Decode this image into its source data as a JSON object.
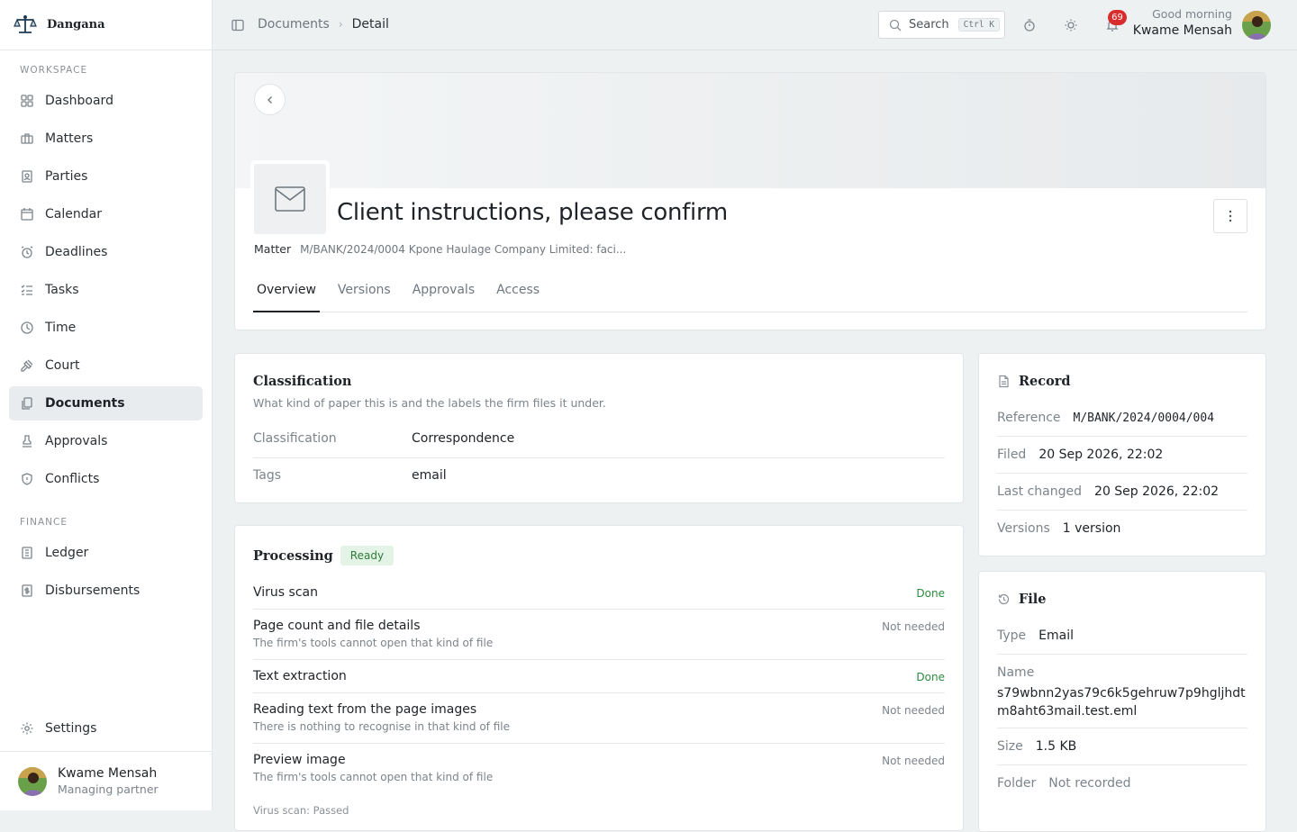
{
  "brand": {
    "name": "Dangana"
  },
  "sidebar": {
    "sections": [
      {
        "label": "Workspace"
      },
      {
        "label": "Finance"
      }
    ],
    "items": [
      {
        "label": "Dashboard",
        "icon": "dashboard-icon"
      },
      {
        "label": "Matters",
        "icon": "briefcase-icon"
      },
      {
        "label": "Parties",
        "icon": "contact-card-icon"
      },
      {
        "label": "Calendar",
        "icon": "calendar-icon"
      },
      {
        "label": "Deadlines",
        "icon": "alarm-clock-icon"
      },
      {
        "label": "Tasks",
        "icon": "checklist-icon"
      },
      {
        "label": "Time",
        "icon": "clock-icon"
      },
      {
        "label": "Court",
        "icon": "gavel-icon"
      },
      {
        "label": "Documents",
        "icon": "documents-icon",
        "active": true
      },
      {
        "label": "Approvals",
        "icon": "stamp-icon"
      },
      {
        "label": "Conflicts",
        "icon": "shield-icon"
      },
      {
        "label": "Ledger",
        "icon": "ledger-icon"
      },
      {
        "label": "Disbursements",
        "icon": "receipt-icon"
      }
    ],
    "settings": "Settings",
    "user": {
      "name": "Kwame Mensah",
      "role": "Managing partner"
    }
  },
  "topbar": {
    "breadcrumb": [
      "Documents",
      "Detail"
    ],
    "search": {
      "label": "Search",
      "shortcut": "Ctrl K"
    },
    "notifications": "69",
    "greeting": "Good morning",
    "user": "Kwame Mensah"
  },
  "document": {
    "title": "Client instructions, please confirm",
    "matter_label": "Matter",
    "matter_value": "M/BANK/2024/0004 Kpone Haulage Company Limited: faci...",
    "tabs": [
      "Overview",
      "Versions",
      "Approvals",
      "Access"
    ],
    "active_tab": "Overview"
  },
  "classification": {
    "title": "Classification",
    "subtitle": "What kind of paper this is and the labels the firm files it under.",
    "rows": [
      {
        "label": "Classification",
        "value": "Correspondence"
      },
      {
        "label": "Tags",
        "value": "email"
      }
    ]
  },
  "processing": {
    "title": "Processing",
    "badge": "Ready",
    "items": [
      {
        "title": "Virus scan",
        "sub": "",
        "status": "Done"
      },
      {
        "title": "Page count and file details",
        "sub": "The firm's tools cannot open that kind of file",
        "status": "Not needed"
      },
      {
        "title": "Text extraction",
        "sub": "",
        "status": "Done"
      },
      {
        "title": "Reading text from the page images",
        "sub": "There is nothing to recognise in that kind of file",
        "status": "Not needed"
      },
      {
        "title": "Preview image",
        "sub": "The firm's tools cannot open that kind of file",
        "status": "Not needed"
      }
    ],
    "footer": "Virus scan: Passed"
  },
  "record": {
    "title": "Record",
    "rows": [
      {
        "label": "Reference",
        "value": "M/BANK/2024/0004/004"
      },
      {
        "label": "Filed",
        "value": "20 Sep 2026, 22:02"
      },
      {
        "label": "Last changed",
        "value": "20 Sep 2026, 22:02"
      },
      {
        "label": "Versions",
        "value": "1 version"
      }
    ]
  },
  "file": {
    "title": "File",
    "type_label": "Type",
    "type_value": "Email",
    "name_label": "Name",
    "name_value": "s79wbnn2yas79c6k5gehruw7p9hgljhdtm8aht63mail.test.eml",
    "size_label": "Size",
    "size_value": "1.5 KB",
    "folder_label": "Folder",
    "folder_value": "Not recorded"
  },
  "colors": {
    "accent": "#1f2328",
    "done": "#2f8a3e",
    "badge_bg": "#e3f4e6",
    "notif": "#d92d2d"
  }
}
